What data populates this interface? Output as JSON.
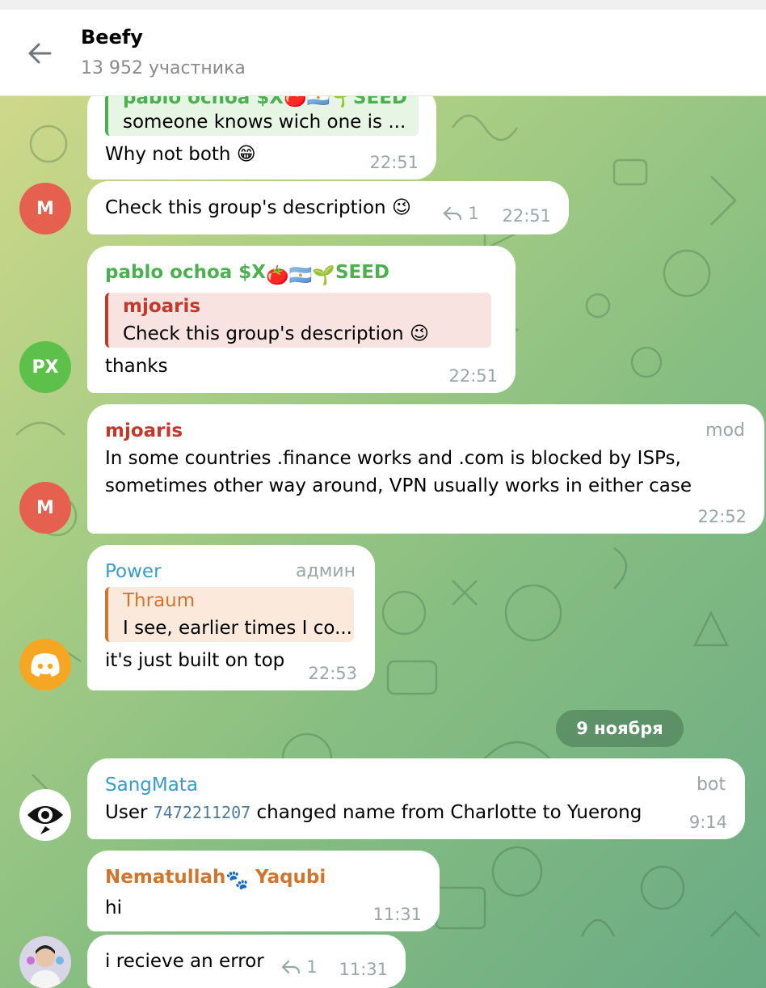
{
  "header": {
    "title": "Beefy",
    "subtitle": "13 952 участника"
  },
  "colors": {
    "green_name": "#4caf50",
    "red_name": "#c0392b",
    "blue_name": "#3a9cc4",
    "orange_name": "#d0752e",
    "avatar_m": "#e5604e",
    "avatar_px": "#5cc04b"
  },
  "messages": [
    {
      "id": "m1",
      "reply": {
        "author": "pablo ochoa $X🍅🇦🇷🌱SEED",
        "text": "someone knows wich one is ..."
      },
      "text": "Why not both 😁",
      "time": "22:51"
    },
    {
      "id": "m2",
      "avatar": "M",
      "text": "Check this group's description 😉",
      "replies": "1",
      "time": "22:51"
    },
    {
      "id": "m3",
      "avatar": "PX",
      "author": "pablo ochoa $X",
      "author_suffix": "SEED",
      "reply": {
        "author": "mjoaris",
        "text": "Check this group's description 😉"
      },
      "text": "thanks",
      "time": "22:51"
    },
    {
      "id": "m4",
      "avatar": "M",
      "author": "mjoaris",
      "tag": "mod",
      "lines": [
        "In some countries .finance works and .com is blocked by ISPs,",
        "sometimes other way around, VPN usually works in either case"
      ],
      "time": "22:52"
    },
    {
      "id": "m5",
      "avatar_icon": "discord-icon",
      "author": "Power",
      "tag": "админ",
      "reply": {
        "author": "Thraum",
        "text": "I see, earlier times I co..."
      },
      "text": "it's just built on top",
      "time": "22:53"
    },
    {
      "id": "m6",
      "avatar_icon": "eye-icon",
      "author": "SangMata",
      "tag": "bot",
      "text_pre": "User ",
      "text_code": "7472211207",
      "text_post": " changed name from Charlotte to Yuerong",
      "time": "9:14"
    },
    {
      "id": "m7",
      "author": "Nematullah",
      "author_suffix": "Yaqubi",
      "text": "hi",
      "time": "11:31"
    },
    {
      "id": "m8",
      "avatar_icon": "user-photo",
      "text": "i recieve an error",
      "replies": "1",
      "time": "11:31"
    }
  ],
  "date_separator": "9 ноября"
}
